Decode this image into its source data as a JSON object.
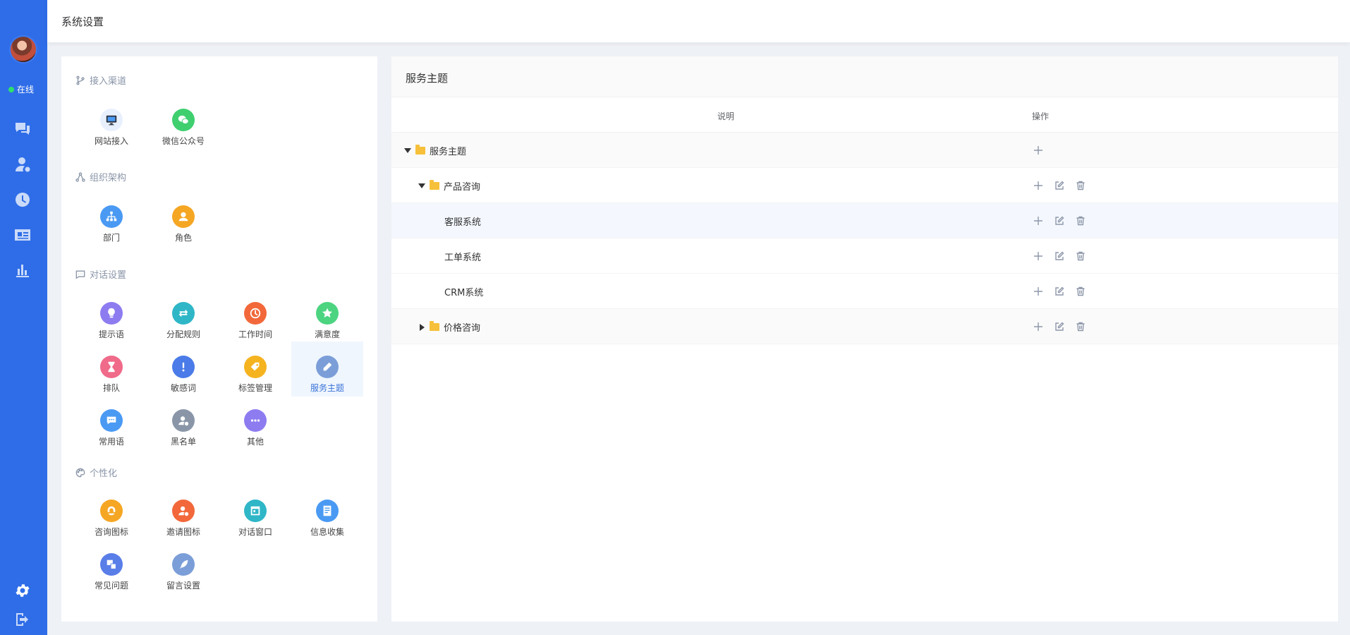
{
  "header": {
    "title": "系统设置"
  },
  "rail": {
    "status_label": "在线",
    "icons": [
      "chat-icon",
      "user-icon",
      "history-icon",
      "contact-card-icon",
      "chart-icon",
      "settings-icon",
      "logout-icon"
    ]
  },
  "settings": {
    "sections": {
      "access": "接入渠道",
      "org": "组织架构",
      "dialog": "对话设置",
      "personal": "个性化"
    },
    "tiles": {
      "website": "网站接入",
      "wechat": "微信公众号",
      "dept": "部门",
      "role": "角色",
      "tips": "提示语",
      "assign": "分配规则",
      "worktime": "工作时间",
      "satisfaction": "满意度",
      "queue": "排队",
      "sensitive": "敏感词",
      "tags": "标签管理",
      "topic": "服务主题",
      "phrases": "常用语",
      "blacklist": "黑名单",
      "other": "其他",
      "consult_icon": "咨询图标",
      "invite_icon": "邀请图标",
      "chat_window": "对话窗口",
      "info_collect": "信息收集",
      "faq": "常见问题",
      "message": "留言设置"
    },
    "colors": {
      "website": "#e8f0fe",
      "wechat": "#3fcf6f",
      "dept": "#4a9af3",
      "role": "#f5a623",
      "tips": "#8d7cf0",
      "assign": "#2fb6c7",
      "worktime": "#f2683a",
      "satisfaction": "#4cd480",
      "queue": "#f06a8a",
      "sensitive": "#4a7be8",
      "tags": "#f5b320",
      "topic": "#7b9ed8",
      "phrases": "#4a9af3",
      "blacklist": "#8a96a8",
      "other": "#8d7cf0",
      "consult_icon": "#f5a623",
      "invite_icon": "#f2683a",
      "chat_window": "#2fb6c7",
      "info_collect": "#4a9af3",
      "faq": "#5a7ee8",
      "message": "#7b9ed8"
    }
  },
  "topics": {
    "title": "服务主题",
    "columns": {
      "desc": "说明",
      "ops": "操作"
    },
    "rows": [
      {
        "label": "服务主题"
      },
      {
        "label": "产品咨询"
      },
      {
        "label": "客服系统"
      },
      {
        "label": "工单系统"
      },
      {
        "label": "CRM系统"
      },
      {
        "label": "价格咨询"
      }
    ]
  }
}
